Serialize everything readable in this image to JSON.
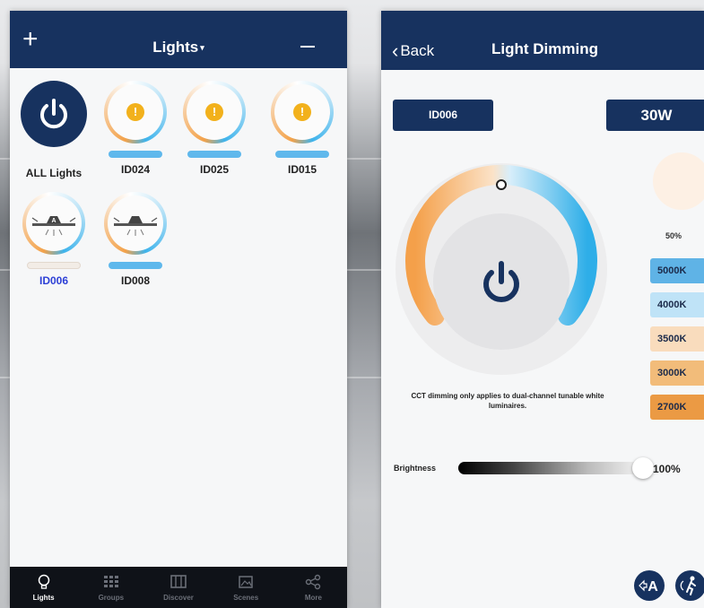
{
  "left_screen": {
    "header": {
      "add_icon": "plus-icon",
      "title": "Lights",
      "title_caret": "▾",
      "remove_icon": "minus-icon"
    },
    "lights": [
      {
        "id": "all",
        "label": "ALL Lights",
        "icon": "power-icon",
        "selected": false
      },
      {
        "id": "ID024",
        "label": "ID024",
        "icon": "warning-icon",
        "warning_glyph": "!",
        "level": 1.0,
        "selected": false
      },
      {
        "id": "ID025",
        "label": "ID025",
        "icon": "warning-icon",
        "warning_glyph": "!",
        "level": 1.0,
        "selected": false
      },
      {
        "id": "ID015",
        "label": "ID015",
        "icon": "warning-icon",
        "warning_glyph": "!",
        "level": 1.0,
        "selected": false
      },
      {
        "id": "ID006",
        "label": "ID006",
        "icon": "fixture-icon",
        "badge": "A",
        "level": 0.0,
        "selected": true
      },
      {
        "id": "ID008",
        "label": "ID008",
        "icon": "fixture-icon",
        "level": 1.0,
        "selected": false
      }
    ],
    "tabs": [
      {
        "label": "Lights",
        "icon": "bulb-icon",
        "active": true
      },
      {
        "label": "Groups",
        "icon": "grid-icon",
        "active": false
      },
      {
        "label": "Discover",
        "icon": "panel-icon",
        "active": false
      },
      {
        "label": "Scenes",
        "icon": "image-icon",
        "active": false
      },
      {
        "label": "More",
        "icon": "share-icon",
        "active": false
      }
    ]
  },
  "right_screen": {
    "header": {
      "back_label": "Back",
      "back_icon": "chevron-left-icon",
      "title": "Light Dimming"
    },
    "device_id": "ID006",
    "wattage": "30W",
    "color_preview": "#fdf0e4",
    "percent": "50%",
    "cct_options": [
      {
        "label": "5000K",
        "color": "#5fb3e6"
      },
      {
        "label": "4000K",
        "color": "#bfe3f7"
      },
      {
        "label": "3500K",
        "color": "#f9dcbd"
      },
      {
        "label": "3000K",
        "color": "#f2bc7a"
      },
      {
        "label": "2700K",
        "color": "#eb9a44"
      }
    ],
    "dial": {
      "warm_color": "#f4a04a",
      "cool_color": "#2eaee8",
      "power_icon": "power-icon",
      "cct_level": 0.5
    },
    "note": "CCT dimming only applies to dual-channel tunable white luminaires.",
    "brightness": {
      "label": "Brightness",
      "value_text": "100%",
      "level": 1.0
    },
    "bottom_buttons": [
      {
        "name": "auto-mode-button",
        "icon": "auto-icon",
        "text": "A"
      },
      {
        "name": "motion-sensor-button",
        "icon": "person-walk-icon"
      }
    ]
  }
}
